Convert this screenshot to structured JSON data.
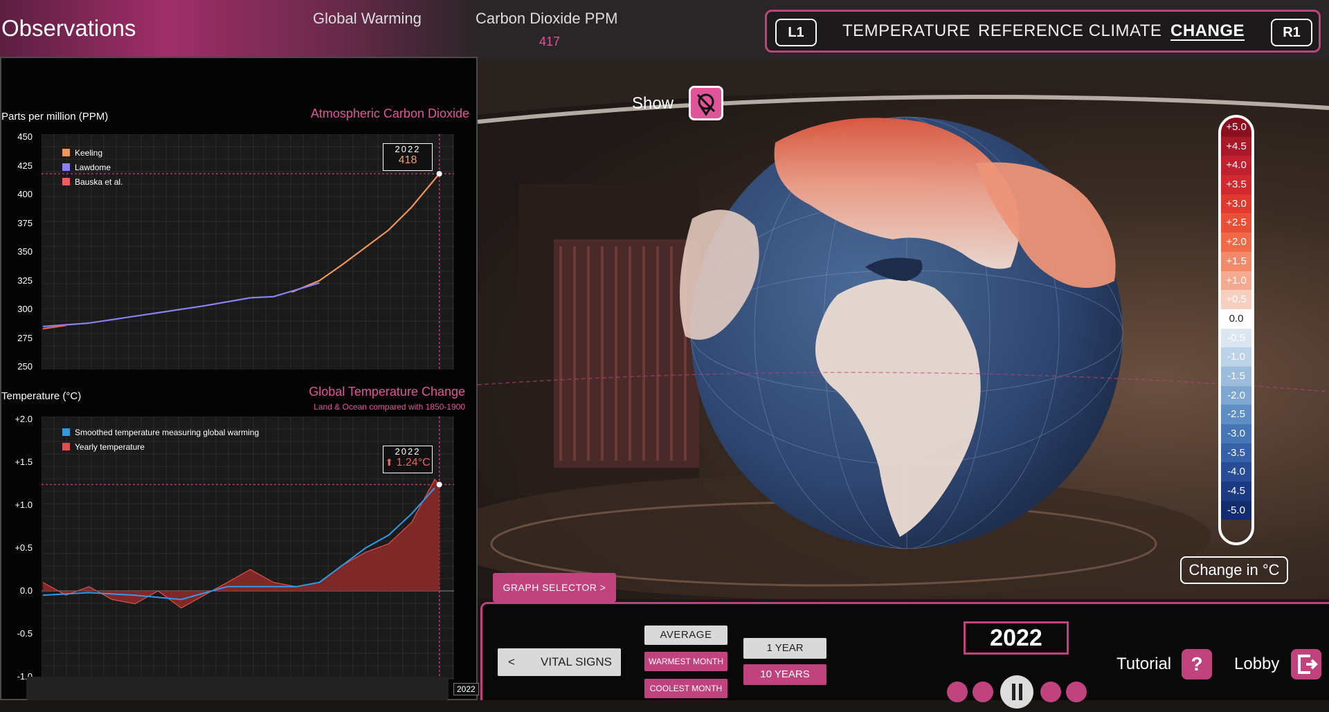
{
  "header": {
    "title": "Observations",
    "stats": [
      {
        "label": "Global Warming",
        "value": ""
      },
      {
        "label": "Carbon Dioxide PPM",
        "value": "417"
      }
    ]
  },
  "modes": {
    "left_button": "L1",
    "right_button": "R1",
    "items": [
      "TEMPERATURE",
      "REFERENCE CLIMATE",
      "CHANGE"
    ],
    "active": "CHANGE"
  },
  "colors": {
    "accent": "#c1437e",
    "accent_light": "#e0559a",
    "keeling": "#f0955a",
    "lawdome": "#8a80f0",
    "bauska": "#e86060",
    "smoothed": "#2f9be8",
    "yearly": "#e05050"
  },
  "chart_data": [
    {
      "type": "line",
      "title": "Atmospheric Carbon Dioxide",
      "ylabel": "Parts per million (PPM)",
      "ylim": [
        250,
        450
      ],
      "yticks": [
        "450",
        "425",
        "400",
        "375",
        "350",
        "325",
        "300",
        "275",
        "250"
      ],
      "xlim": [
        1850,
        2023
      ],
      "legend": "top-left",
      "series": [
        {
          "name": "Keeling",
          "x": [
            1958,
            1970,
            1980,
            1990,
            2000,
            2010,
            2022
          ],
          "y": [
            315,
            325,
            339,
            354,
            369,
            389,
            418
          ]
        },
        {
          "name": "Lawdome",
          "x": [
            1850,
            1870,
            1890,
            1900,
            1920,
            1940,
            1950,
            1960,
            1970
          ],
          "y": [
            285,
            288,
            294,
            297,
            303,
            310,
            311,
            317,
            323
          ]
        },
        {
          "name": "Bauska et al.",
          "x": [
            1850,
            1860
          ],
          "y": [
            283,
            286
          ]
        }
      ],
      "callout": {
        "year": "2022",
        "value": "418"
      }
    },
    {
      "type": "area",
      "title": "Global Temperature Change",
      "subtitle": "Land & Ocean compared with 1850-1900",
      "ylabel": "Temperature (°C)",
      "ylim": [
        -1.0,
        2.0
      ],
      "yticks": [
        "+2.0",
        "+1.5",
        "+1.0",
        "+0.5",
        "0.0",
        "-0.5",
        "-1.0"
      ],
      "xlim": [
        1850,
        2023
      ],
      "legend": "top-left",
      "series": [
        {
          "name": "Smoothed temperature measuring global warming",
          "x": [
            1850,
            1870,
            1890,
            1910,
            1930,
            1950,
            1960,
            1970,
            1980,
            1990,
            2000,
            2010,
            2020
          ],
          "y": [
            -0.05,
            -0.02,
            -0.05,
            -0.1,
            0.05,
            0.05,
            0.05,
            0.1,
            0.3,
            0.5,
            0.65,
            0.9,
            1.2
          ]
        },
        {
          "name": "Yearly temperature",
          "x": [
            1850,
            1860,
            1870,
            1880,
            1890,
            1900,
            1910,
            1920,
            1930,
            1940,
            1950,
            1960,
            1970,
            1980,
            1990,
            2000,
            2010,
            2015,
            2020,
            2022
          ],
          "y": [
            0.1,
            -0.05,
            0.05,
            -0.1,
            -0.15,
            0.0,
            -0.2,
            -0.05,
            0.1,
            0.25,
            0.1,
            0.05,
            0.1,
            0.3,
            0.45,
            0.55,
            0.8,
            1.05,
            1.3,
            1.24
          ]
        }
      ],
      "callout": {
        "year": "2022",
        "value": "1.24°C"
      }
    }
  ],
  "globe": {
    "show_label": "Show",
    "scale_label": "Change in °C",
    "scale": [
      "+5.0",
      "+4.5",
      "+4.0",
      "+3.5",
      "+3.0",
      "+2.5",
      "+2.0",
      "+1.5",
      "+1.0",
      "+0.5",
      "0.0",
      "-0.5",
      "-1.0",
      "-1.5",
      "-2.0",
      "-2.5",
      "-3.0",
      "-3.5",
      "-4.0",
      "-4.5",
      "-5.0"
    ]
  },
  "graph_selector": "GRAPH SELECTOR  >",
  "controls": {
    "vital_signs_arrow": "<",
    "vital_signs": "VITAL SIGNS",
    "average": "AVERAGE",
    "warmest_month": "WARMEST MONTH",
    "coolest_month": "COOLEST MONTH",
    "one_year": "1 YEAR",
    "ten_years": "10 YEARS",
    "year": "2022",
    "tutorial": "Tutorial",
    "tutorial_icon": "?",
    "lobby": "Lobby",
    "timeline_year": "2022"
  }
}
